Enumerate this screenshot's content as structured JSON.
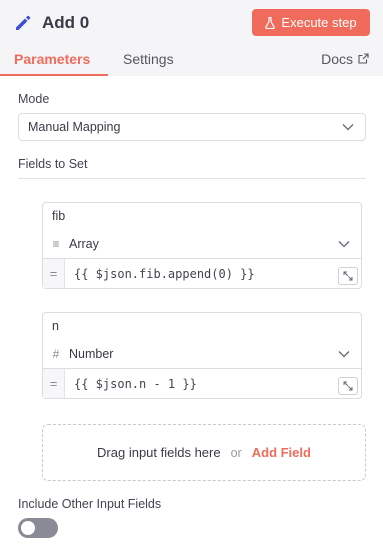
{
  "header": {
    "title": "Add 0",
    "execute_label": "Execute step",
    "accent": "#f06b5b"
  },
  "tabs": [
    {
      "label": "Parameters",
      "active": true
    },
    {
      "label": "Settings",
      "active": false
    }
  ],
  "docs_label": "Docs",
  "mode": {
    "label": "Mode",
    "value": "Manual Mapping"
  },
  "fields_label": "Fields to Set",
  "fields": [
    {
      "name": "fib",
      "type": "Array",
      "type_icon": "list-icon",
      "value": "{{ $json.fib.append(0) }}"
    },
    {
      "name": "n",
      "type": "Number",
      "type_icon": "hash-icon",
      "value": "{{ $json.n - 1 }}"
    }
  ],
  "drop_zone": {
    "text": "Drag input fields here",
    "or": "or",
    "add_label": "Add Field"
  },
  "include_other": {
    "label": "Include Other Input Fields",
    "enabled": false
  }
}
